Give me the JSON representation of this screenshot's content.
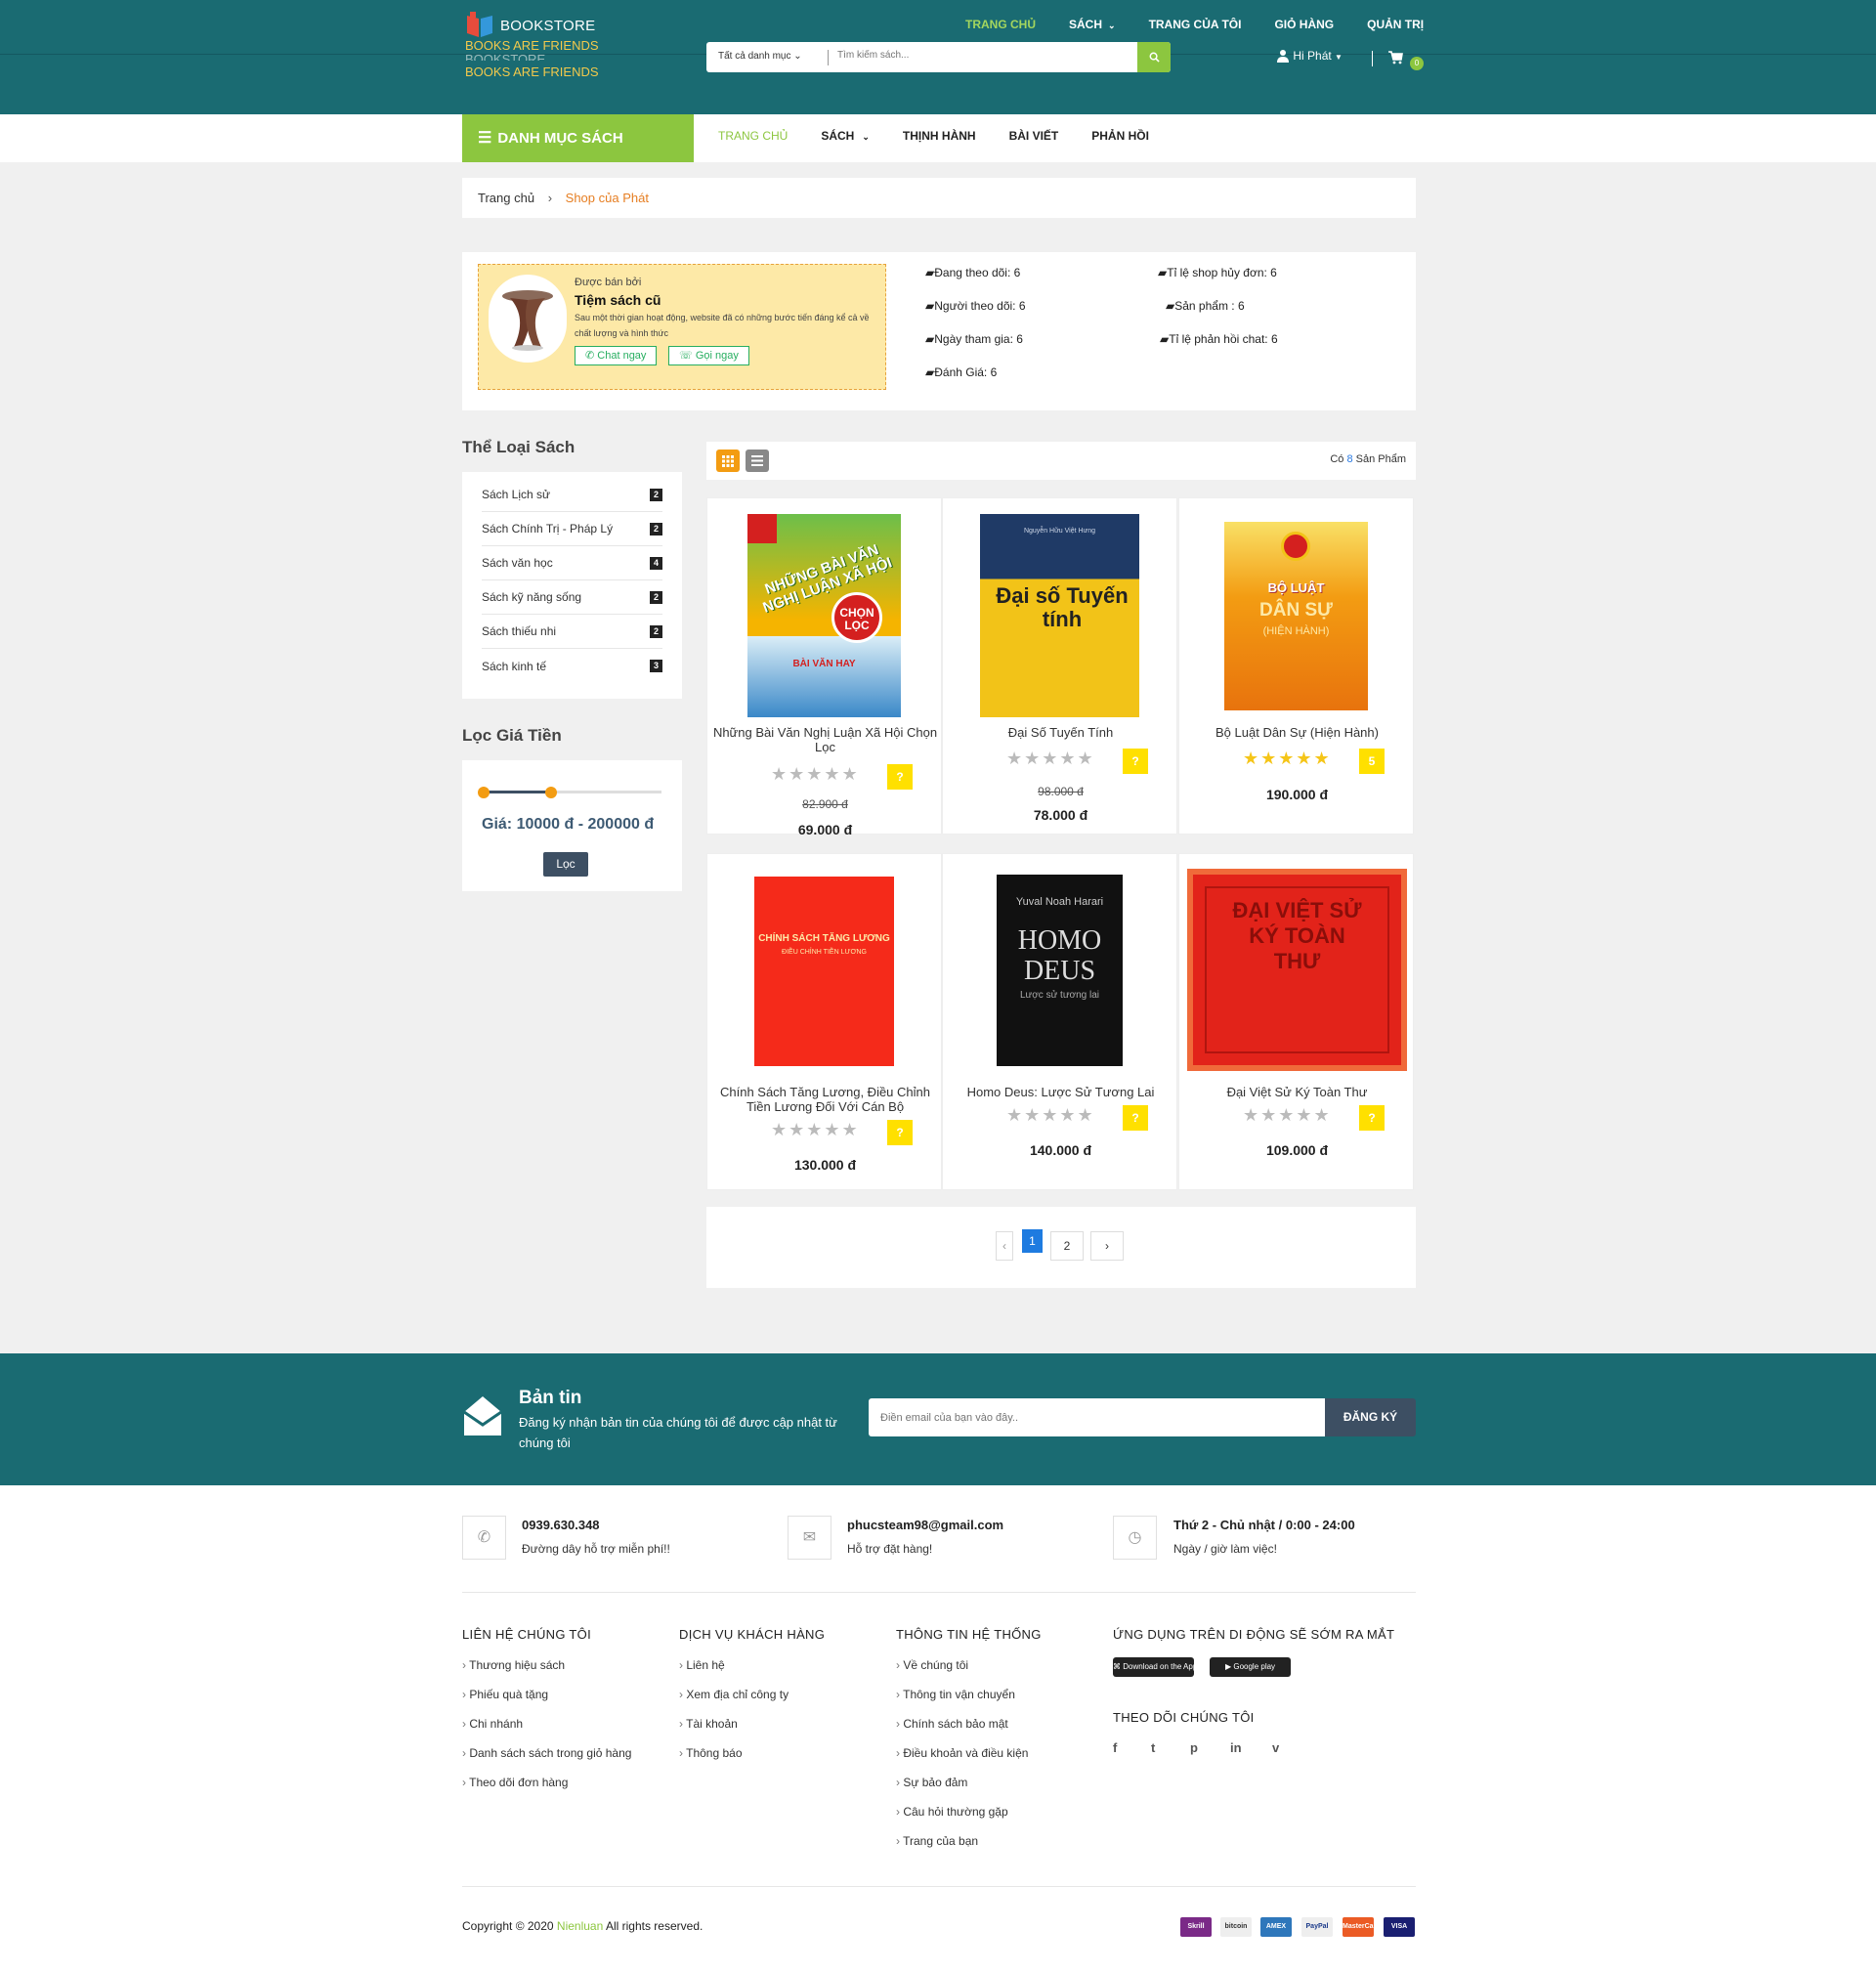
{
  "header": {
    "logo_title": "BOOKSTORE",
    "logo_tagline": "BOOKS ARE FRIENDS",
    "logo_ghost": "BOOKSTORE",
    "logo_tagline2": "BOOKS ARE FRIENDS",
    "top_nav": [
      "TRANG CHỦ",
      "SÁCH",
      "TRANG CỦA TÔI",
      "GIỎ HÀNG",
      "QUẢN TRỊ"
    ],
    "search_category": "Tất cả danh mục",
    "search_placeholder": "Tìm kiếm sách...",
    "user_greeting": "Hi Phát",
    "cart_count": "0"
  },
  "navbar": {
    "category_button": "DANH MỤC SÁCH",
    "items": [
      "TRANG CHỦ",
      "SÁCH",
      "THỊNH HÀNH",
      "BÀI VIẾT",
      "PHẢN HỒI"
    ]
  },
  "breadcrumb": {
    "home": "Trang chủ",
    "current": "Shop của Phát"
  },
  "seller": {
    "label": "Được bán bởi",
    "name": "Tiệm sách cũ",
    "description": "Sau một thời gian hoạt động, website đã có những bước tiến đáng kể cả về chất lượng và hình thức",
    "chat_button": "Chat ngay",
    "call_button": "Gọi ngay"
  },
  "stats": [
    "Đang theo dõi: 6",
    "Tỉ lệ shop hủy đơn: 6",
    "Người theo dõi: 6",
    "Sản phẩm : 6",
    "Ngày tham gia: 6",
    "Tỉ lệ phản hồi chat: 6",
    "Đánh Giá: 6"
  ],
  "sidebar": {
    "categories_title": "Thể Loại Sách",
    "categories": [
      {
        "name": "Sách Lịch sử",
        "count": "2"
      },
      {
        "name": "Sách Chính Trị - Pháp Lý",
        "count": "2"
      },
      {
        "name": "Sách văn học",
        "count": "4"
      },
      {
        "name": "Sách kỹ năng sống",
        "count": "2"
      },
      {
        "name": "Sách thiếu nhi",
        "count": "2"
      },
      {
        "name": "Sách kinh tế",
        "count": "3"
      }
    ],
    "price_title": "Lọc Giá Tiền",
    "price_range": "Giá:  10000 đ - 200000 đ",
    "slider_low_fraction": 0.0,
    "slider_high_fraction": 0.38,
    "filter_button": "Lọc"
  },
  "products_header": {
    "prefix": "Có",
    "count": "8",
    "suffix": "Sản Phẩm"
  },
  "products": [
    {
      "title": "Những Bài Văn Nghị Luận Xã Hội Chọn Lọc",
      "old_price": "82.900 đ",
      "price": "69.000 đ",
      "rating": "?",
      "stars": 0,
      "cover_text": "NHỮNG BÀI VĂN NGHỊ LUẬN XÃ HỘI",
      "cover_badge": "CHỌN LỌC",
      "cover_sub": "BÀI VĂN HAY"
    },
    {
      "title": "Đại Số Tuyến Tính",
      "old_price": "98.000 đ",
      "price": "78.000 đ",
      "rating": "?",
      "stars": 0,
      "cover_text": "Đại số Tuyến tính",
      "cover_author": "Nguyễn Hữu Việt Hưng"
    },
    {
      "title": "Bộ Luật Dân Sự (Hiện Hành)",
      "old_price": "",
      "price": "190.000 đ",
      "rating": "5",
      "stars": 5,
      "cover_text": "BỘ LUẬT",
      "cover_badge": "DÂN SỰ",
      "cover_sub": "(HIỆN HÀNH)"
    },
    {
      "title": "Chính Sách Tăng Lương, Điều Chỉnh Tiền Lương Đối Với Cán Bộ",
      "old_price": "",
      "price": "130.000 đ",
      "rating": "?",
      "stars": 0,
      "cover_text": "CHÍNH SÁCH TĂNG LƯƠNG",
      "cover_sub": "ĐIỀU CHỈNH TIỀN LƯƠNG"
    },
    {
      "title": "Homo Deus: Lược Sử Tương Lai",
      "old_price": "",
      "price": "140.000 đ",
      "rating": "?",
      "stars": 0,
      "cover_author": "Yuval Noah Harari",
      "cover_text": "HOMO DEUS",
      "cover_sub": "Lược sử tương lai"
    },
    {
      "title": "Đại Việt Sử Ký Toàn Thư",
      "old_price": "",
      "price": "109.000 đ",
      "rating": "?",
      "stars": 0,
      "cover_text": "ĐẠI VIỆT SỬ KÝ TOÀN THƯ"
    }
  ],
  "pagination": {
    "prev": "‹",
    "pages": [
      "1",
      "2"
    ],
    "next": "›",
    "current": "1"
  },
  "newsletter": {
    "title": "Bản tin",
    "text": "Đăng ký nhận bản tin của chúng tôi để được cập nhật từ chúng tôi",
    "placeholder": "Điền email của bạn vào đây..",
    "button": "ĐĂNG KÝ"
  },
  "contact": [
    {
      "title": "0939.630.348",
      "sub": "Đường dây hỗ trợ miễn phí!!",
      "icon": "phone-icon"
    },
    {
      "title": "phucsteam98@gmail.com",
      "sub": "Hỗ trợ đặt hàng!",
      "icon": "mail-icon"
    },
    {
      "title": "Thứ 2 - Chủ nhật / 0:00 - 24:00",
      "sub": "Ngày / giờ làm việc!",
      "icon": "clock-icon"
    }
  ],
  "footer": {
    "col1": {
      "title": "LIÊN HỆ CHÚNG TÔI",
      "links": [
        "Thương hiệu sách",
        "Phiếu quà tặng",
        "Chi nhánh",
        "Danh sách sách trong giỏ hàng",
        "Theo dõi đơn hàng"
      ]
    },
    "col2": {
      "title": "DỊCH VỤ KHÁCH HÀNG",
      "links": [
        "Liên hệ",
        "Xem địa chỉ công ty",
        "Tài khoản",
        "Thông báo"
      ]
    },
    "col3": {
      "title": "THÔNG TIN HỆ THỐNG",
      "links": [
        "Về chúng tôi",
        "Thông tin vận chuyển",
        "Chính sách bảo mật",
        "Điều khoản và điều kiện",
        "Sự bảo đảm",
        "Câu hỏi thường gặp",
        "Trang của bạn"
      ]
    },
    "col4": {
      "title": "ỨNG DỤNG TRÊN DI ĐỘNG SẼ SỚM RA MẮT",
      "app_store": "Download on the App Store",
      "google_play": "Google play",
      "follow_title": "THEO DÕI CHÚNG TÔI",
      "social": [
        "f",
        "t",
        "p",
        "in",
        "v"
      ]
    },
    "copyright_prefix": "Copyright © 2020",
    "copyright_brand": "Nienluan",
    "copyright_suffix": "All rights reserved.",
    "payments": [
      "Skrill",
      "bitcoin",
      "AMEX",
      "PayPal",
      "MasterCard",
      "VISA"
    ]
  },
  "colors": {
    "header": "#1a6b72",
    "accent": "#8cc63f",
    "dark": "#3d4f63",
    "orange": "#e67e22"
  }
}
